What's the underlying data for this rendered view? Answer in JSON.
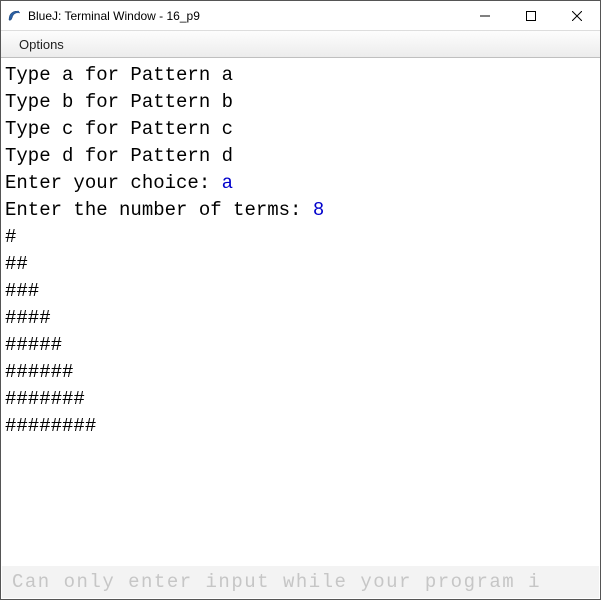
{
  "window": {
    "title": "BlueJ: Terminal Window - 16_p9"
  },
  "menubar": {
    "options": "Options"
  },
  "terminal": {
    "line1": "Type a for Pattern a",
    "line2": "Type b for Pattern b",
    "line3": "Type c for Pattern c",
    "line4": "Type d for Pattern d",
    "prompt1": "Enter your choice: ",
    "input1": "a",
    "prompt2": "Enter the number of terms: ",
    "input2": "8",
    "out1": "#",
    "out2": "##",
    "out3": "###",
    "out4": "####",
    "out5": "#####",
    "out6": "######",
    "out7": "#######",
    "out8": "########"
  },
  "footer": {
    "placeholder": "Can only enter input while your program i"
  }
}
